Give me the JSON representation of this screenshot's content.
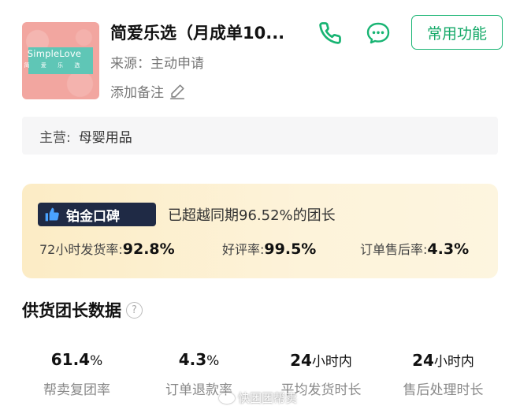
{
  "header": {
    "title": "简爱乐选（月成单10...",
    "source": "来源：主动申请",
    "remark": "添加备注",
    "common_button": "常用功能",
    "logo": {
      "brand": "SimpleLove",
      "sub": "简 爱 乐 选"
    }
  },
  "main_business": {
    "label": "主营:",
    "value": "母婴用品"
  },
  "reputation": {
    "badge": "铂金口碑",
    "description": "已超越同期96.52%的团长",
    "metrics": [
      {
        "label": "72小时发货率:",
        "value": "92.8%"
      },
      {
        "label": "好评率:",
        "value": "99.5%"
      },
      {
        "label": "订单售后率:",
        "value": "4.3%"
      }
    ]
  },
  "supply": {
    "title": "供货团长数据",
    "help": "?",
    "stats": [
      {
        "value": "61.4",
        "unit": "%",
        "label": "帮卖复团率"
      },
      {
        "value": "4.3",
        "unit": "%",
        "label": "订单退款率"
      },
      {
        "value": "24",
        "unit": "小时内",
        "label": "平均发货时长"
      },
      {
        "value": "24",
        "unit": "小时内",
        "label": "售后处理时长"
      }
    ]
  },
  "watermark": "快团团帮卖",
  "colors": {
    "accent": "#18b473",
    "badge_bg": "#1f2a45",
    "reputation_bg": "#fcecc5",
    "logo_bg": "#f2a6a0"
  },
  "icons": [
    "phone-icon",
    "chat-icon",
    "edit-pencil-icon",
    "thumbs-up-icon",
    "help-icon"
  ]
}
